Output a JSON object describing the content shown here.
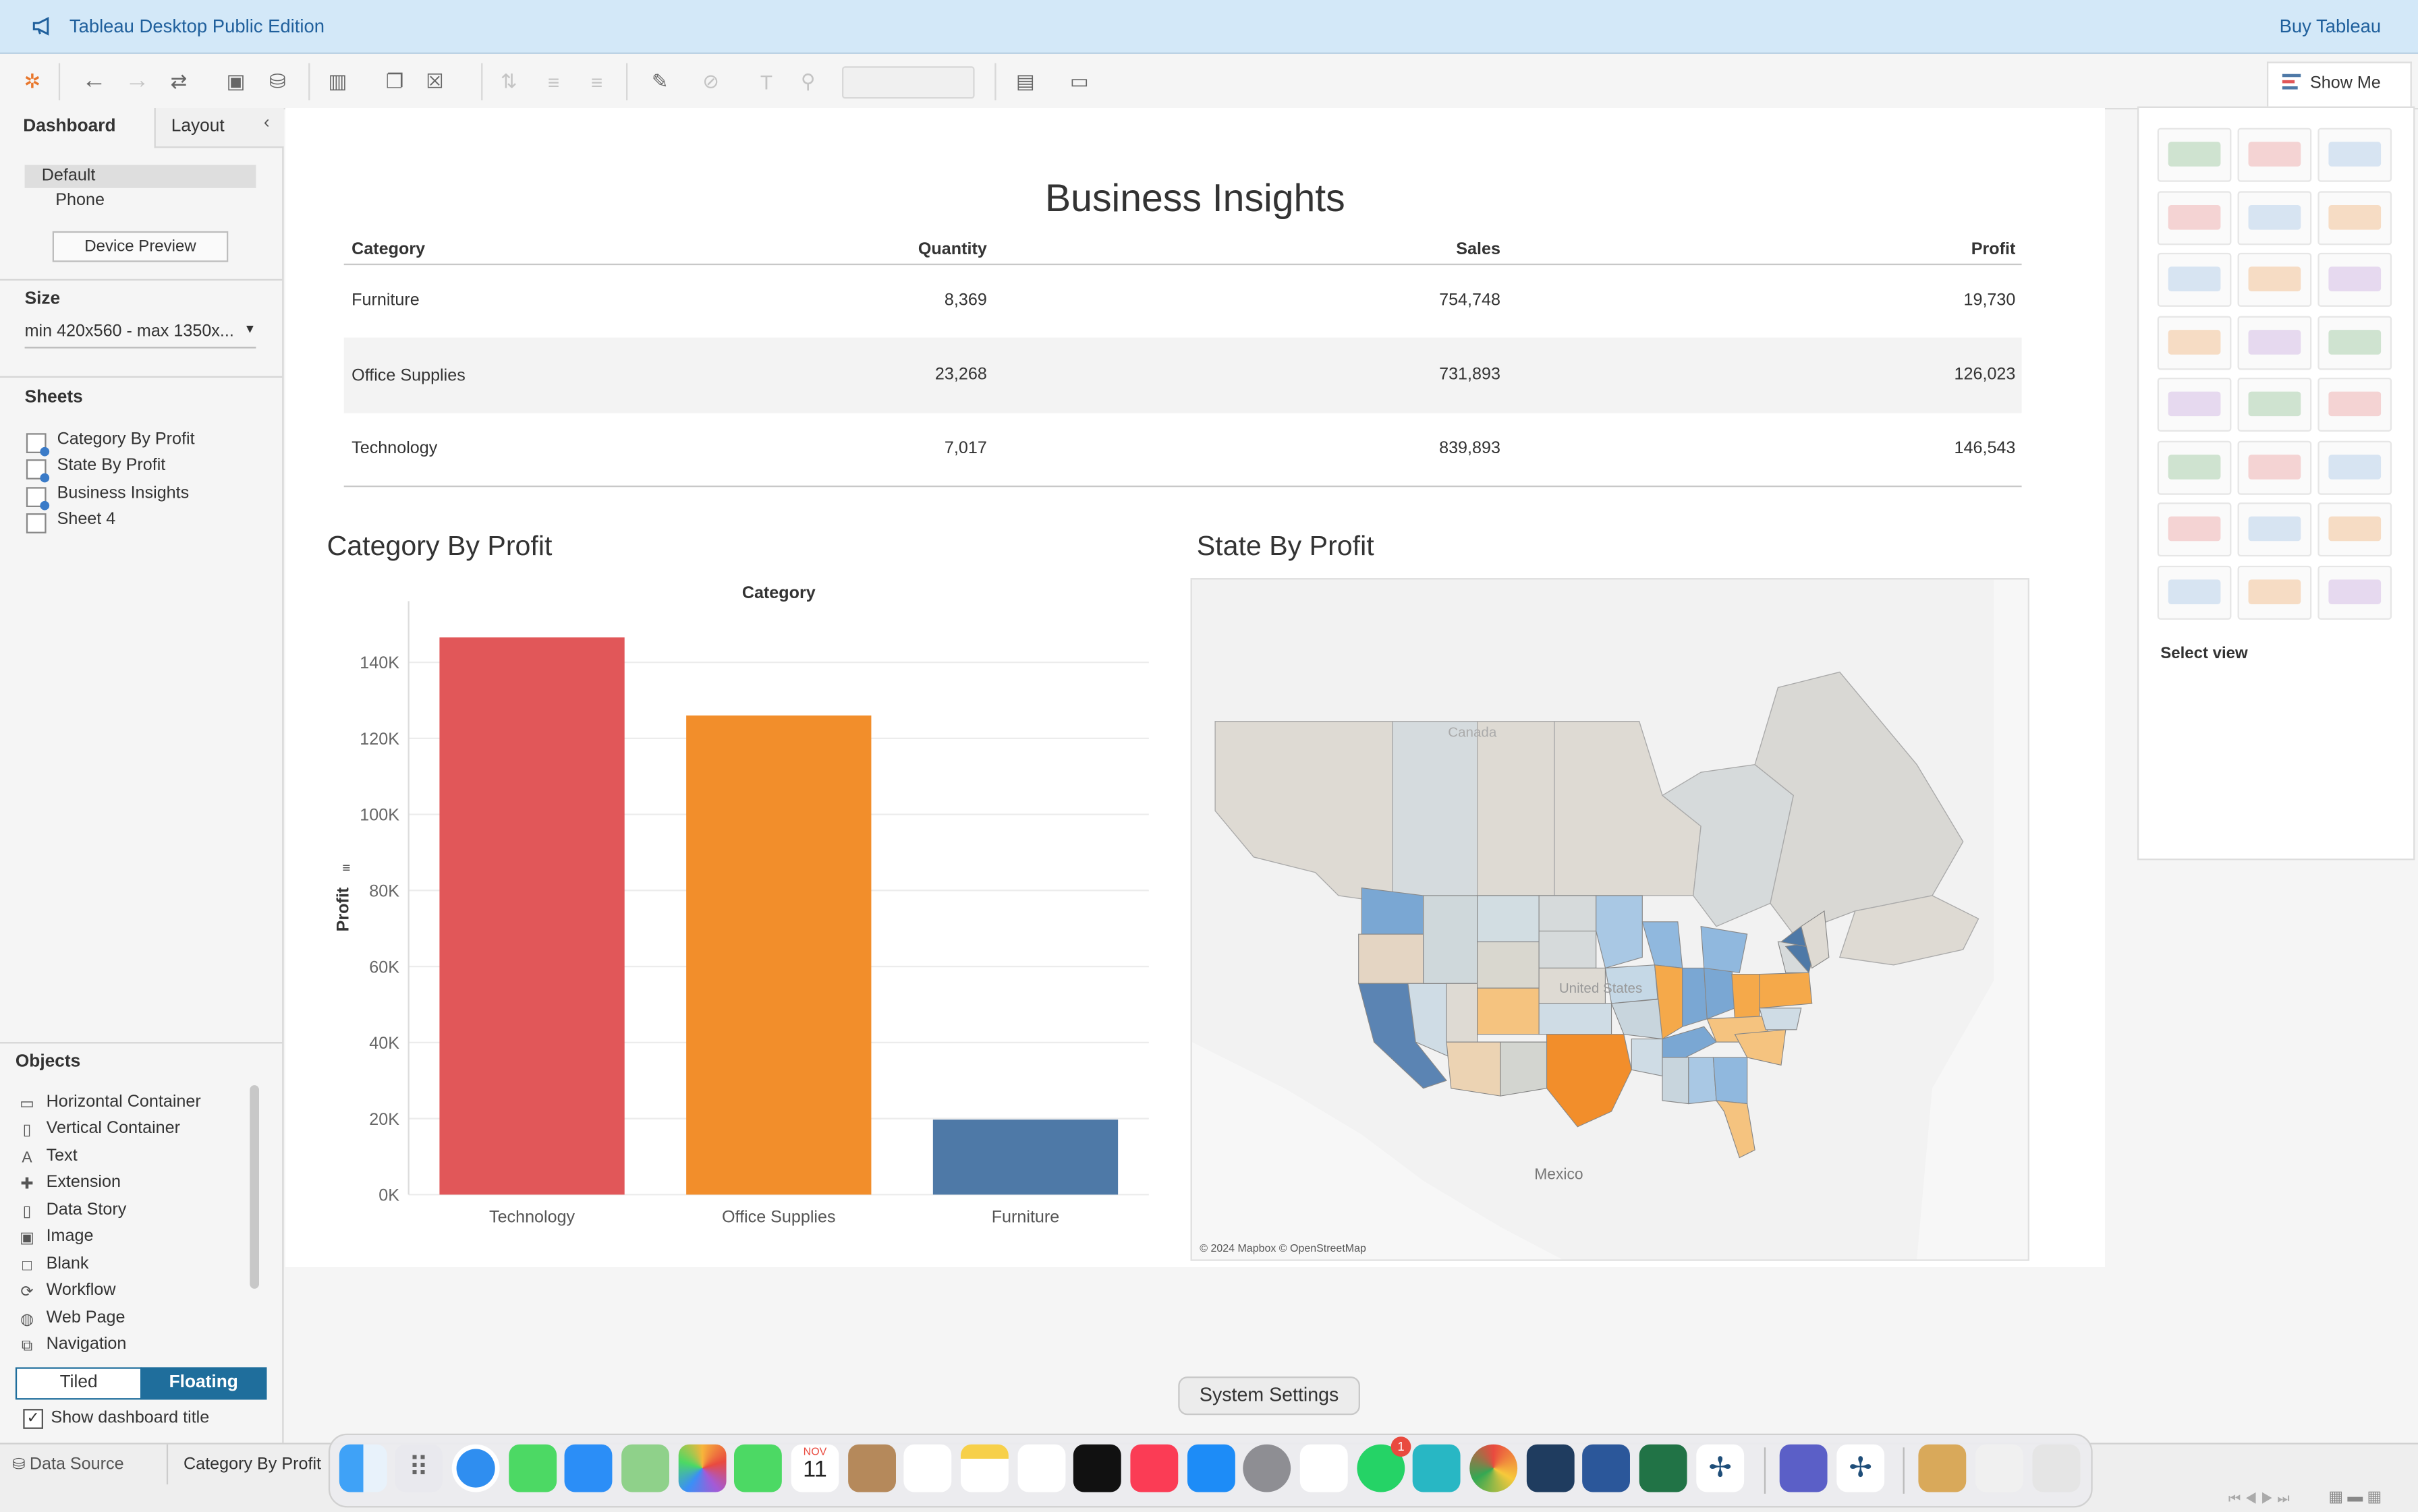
{
  "window": {
    "app_title": "Tableau Desktop Public Edition",
    "buy_link": "Buy Tableau",
    "show_me": "Show Me"
  },
  "left_panel": {
    "tab_dashboard": "Dashboard",
    "tab_layout": "Layout",
    "devices": [
      "Default",
      "Phone"
    ],
    "device_preview": "Device Preview",
    "size_heading": "Size",
    "size_value": "min 420x560 - max 1350x...",
    "sheets_heading": "Sheets",
    "sheets": [
      "Category By Profit",
      "State By Profit",
      "Business Insights",
      "Sheet 4"
    ],
    "objects_heading": "Objects",
    "objects": [
      "Horizontal Container",
      "Vertical Container",
      "Text",
      "Extension",
      "Data Story",
      "Image",
      "Blank",
      "Workflow",
      "Web Page",
      "Navigation"
    ],
    "tiled": "Tiled",
    "floating": "Floating",
    "show_title": "Show dashboard title"
  },
  "dashboard": {
    "title": "Business Insights",
    "table": {
      "headers": [
        "Category",
        "Quantity",
        "Sales",
        "Profit"
      ],
      "rows": [
        [
          "Furniture",
          "8,369",
          "754,748",
          "19,730"
        ],
        [
          "Office Supplies",
          "23,268",
          "731,893",
          "126,023"
        ],
        [
          "Technology",
          "7,017",
          "839,893",
          "146,543"
        ]
      ]
    },
    "bar_sheet_title": "Category By Profit",
    "map_sheet_title": "State By Profit",
    "map_labels": {
      "canada": "Canada",
      "united_states": "United States",
      "mexico": "Mexico",
      "credit": "© 2024 Mapbox © OpenStreetMap"
    }
  },
  "chart_data": {
    "type": "bar",
    "title": "Category",
    "categories": [
      "Technology",
      "Office Supplies",
      "Furniture"
    ],
    "values": [
      146543,
      126023,
      19730
    ],
    "colors": [
      "#e15759",
      "#f28e2b",
      "#4e79a7"
    ],
    "ylabel": "Profit",
    "ylim": [
      0,
      150000
    ],
    "yticks": [
      0,
      20000,
      40000,
      60000,
      80000,
      100000,
      120000,
      140000
    ],
    "ytick_labels": [
      "0K",
      "20K",
      "40K",
      "60K",
      "80K",
      "100K",
      "120K",
      "140K"
    ],
    "grid": true
  },
  "show_me_panel": {
    "select_view": "Select view"
  },
  "bottom_bar": {
    "data_source": "Data Source",
    "sheet_tab": "Category By Profit"
  },
  "dock": {
    "tooltip": "System Settings",
    "calendar_month": "NOV",
    "calendar_day": "11",
    "whatsapp_badge": "1"
  }
}
